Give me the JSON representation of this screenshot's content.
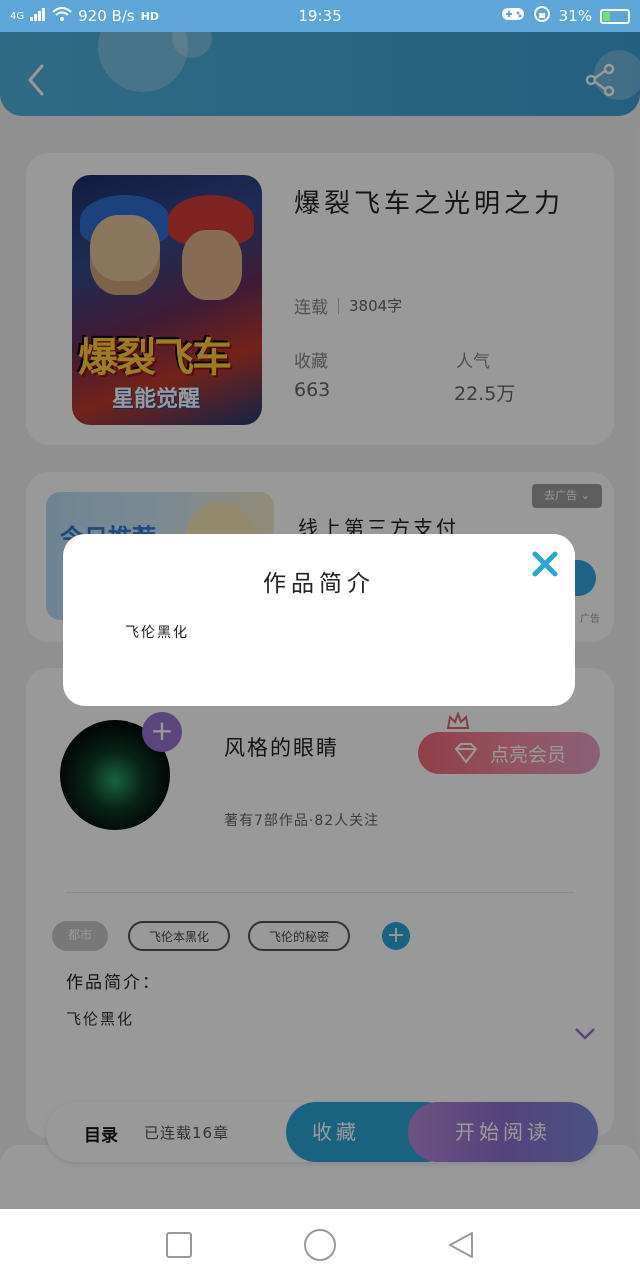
{
  "status_bar": {
    "network": "4G",
    "speed": "920 B/s",
    "hd": "HD",
    "time": "19:35",
    "battery": "31%",
    "battery_level": 0.31
  },
  "book": {
    "title": "爆裂飞车之光明之力",
    "cover_title": "爆裂飞车",
    "cover_subtitle": "星能觉醒",
    "status": "连载",
    "word_count": "3804字",
    "favorites_label": "收藏",
    "favorites_value": "663",
    "popularity_label": "人气",
    "popularity_value": "22.5万"
  },
  "ad": {
    "image_text": "今日推荐",
    "title": "线上第三方支付",
    "close_label": "去广告",
    "ad_mark": "广告"
  },
  "author": {
    "name": "风格的眼睛",
    "meta": "著有7部作品·82人关注",
    "vip_label": "点亮会员",
    "follow_label": "+"
  },
  "tags": {
    "genre": "都市",
    "items": [
      "飞伦本黑化",
      "飞伦的秘密"
    ],
    "add_label": "+"
  },
  "intro": {
    "label": "作品简介：",
    "text": "飞伦黑化"
  },
  "action_bar": {
    "toc_label": "目录",
    "chapter_count": "已连载16章",
    "favorite_label": "收藏",
    "read_label": "开始阅读"
  },
  "modal": {
    "title": "作品简介",
    "body": "飞伦黑化"
  },
  "colors": {
    "header": "#4aaadb",
    "accent_blue": "#2aa6d6",
    "accent_purple": "#9a74d0",
    "vip_pink": "#f06a78"
  }
}
